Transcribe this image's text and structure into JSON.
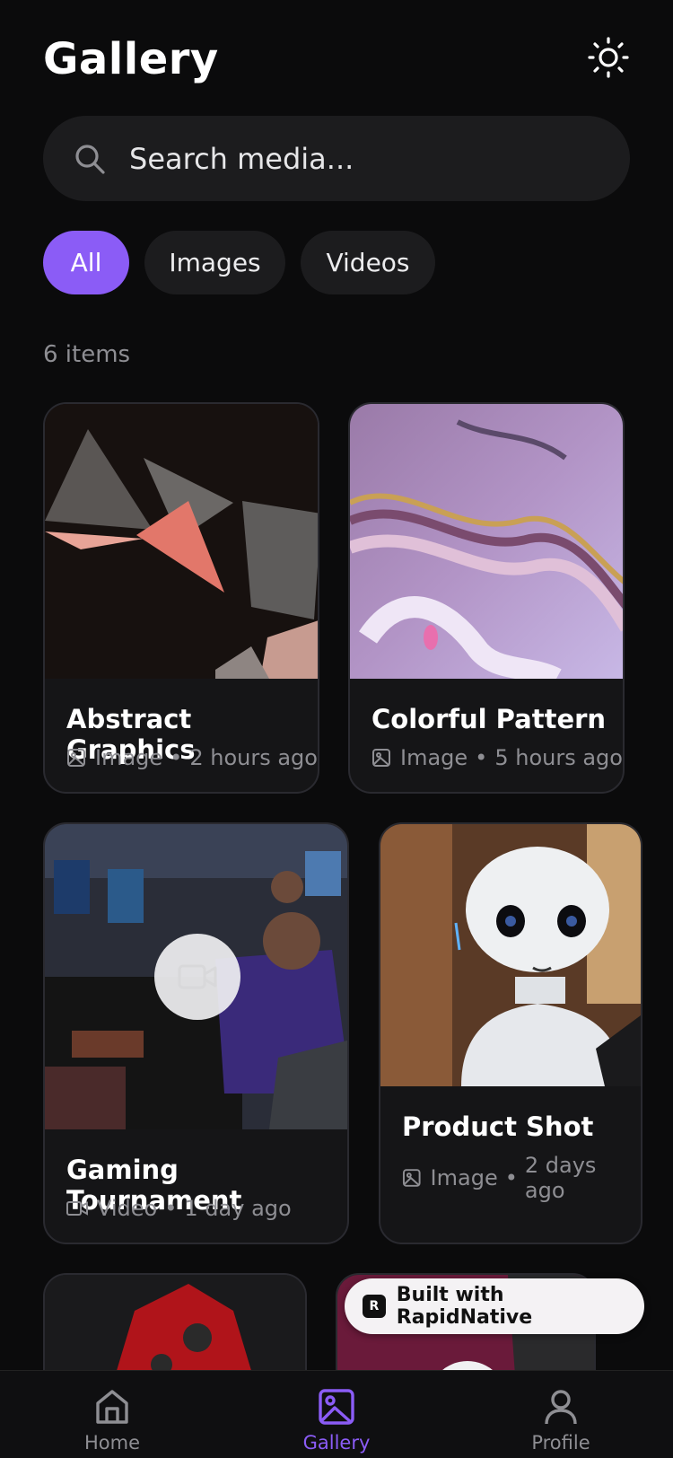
{
  "header": {
    "title": "Gallery",
    "theme_icon": "sun-icon"
  },
  "search": {
    "placeholder": "Search media..."
  },
  "filters": [
    {
      "label": "All",
      "active": true
    },
    {
      "label": "Images",
      "active": false
    },
    {
      "label": "Videos",
      "active": false
    }
  ],
  "count": "6 items",
  "items": [
    {
      "title": "Abstract Graphics",
      "type": "Image",
      "time": "2 hours ago"
    },
    {
      "title": "Colorful Pattern",
      "type": "Image",
      "time": "5 hours ago"
    },
    {
      "title": "Gaming Tournament",
      "type": "Video",
      "time": "1 day ago"
    },
    {
      "title": "Product Shot",
      "type": "Image",
      "time": "2 days ago"
    }
  ],
  "meta_separator": "•",
  "badge": {
    "label": "Built with RapidNative"
  },
  "tabs": [
    {
      "label": "Home",
      "active": false
    },
    {
      "label": "Gallery",
      "active": true
    },
    {
      "label": "Profile",
      "active": false
    }
  ],
  "colors": {
    "accent": "#8b5cf6",
    "background": "#0b0b0c",
    "surface": "#1c1c1e"
  }
}
